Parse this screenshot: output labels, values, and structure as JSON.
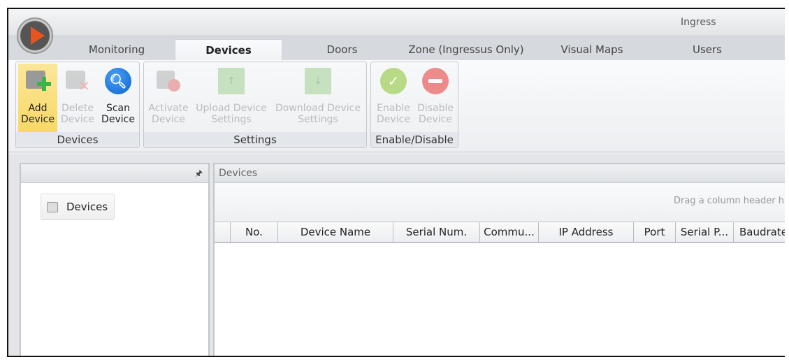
{
  "app": {
    "title": "Ingress"
  },
  "tabs": [
    "Monitoring",
    "Devices",
    "Doors",
    "Zone (Ingressus Only)",
    "Visual Maps",
    "Users"
  ],
  "ribbon": {
    "groups": [
      {
        "label": "Devices",
        "buttons": [
          {
            "l1": "Add",
            "l2": "Device"
          },
          {
            "l1": "Delete",
            "l2": "Device"
          },
          {
            "l1": "Scan",
            "l2": "Device"
          }
        ]
      },
      {
        "label": "Settings",
        "buttons": [
          {
            "l1": "Activate",
            "l2": "Device"
          },
          {
            "l1": "Upload Device",
            "l2": "Settings"
          },
          {
            "l1": "Download Device",
            "l2": "Settings"
          }
        ]
      },
      {
        "label": "Enable/Disable",
        "buttons": [
          {
            "l1": "Enable",
            "l2": "Device"
          },
          {
            "l1": "Disable",
            "l2": "Device"
          }
        ]
      }
    ]
  },
  "left_panel": {
    "pin": "🖈",
    "tree_item": "Devices"
  },
  "right_panel": {
    "title": "Devices",
    "group_hint": "Drag a column header h",
    "columns": [
      "No.",
      "Device Name",
      "Serial Num.",
      "Commu...",
      "IP Address",
      "Port",
      "Serial P...",
      "Baudrate"
    ]
  }
}
